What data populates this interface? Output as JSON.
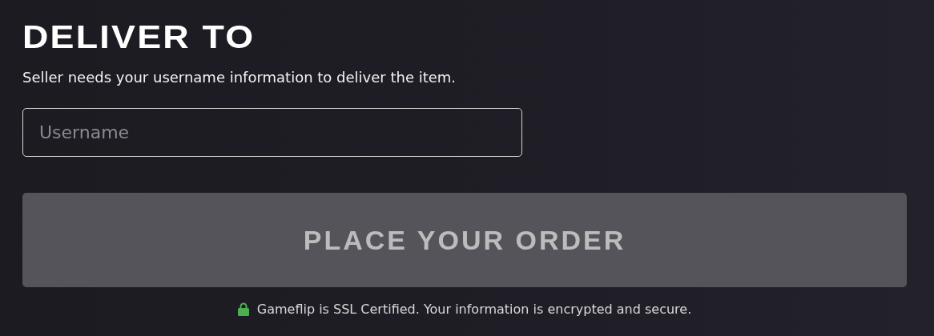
{
  "section": {
    "title": "DELIVER TO",
    "description": "Seller needs your username information to deliver the item."
  },
  "username_field": {
    "placeholder": "Username"
  },
  "order_button": {
    "label": "PLACE YOUR ORDER",
    "disabled": true
  },
  "security_note": "Gameflip is SSL Certified. Your information is encrypted and secure."
}
